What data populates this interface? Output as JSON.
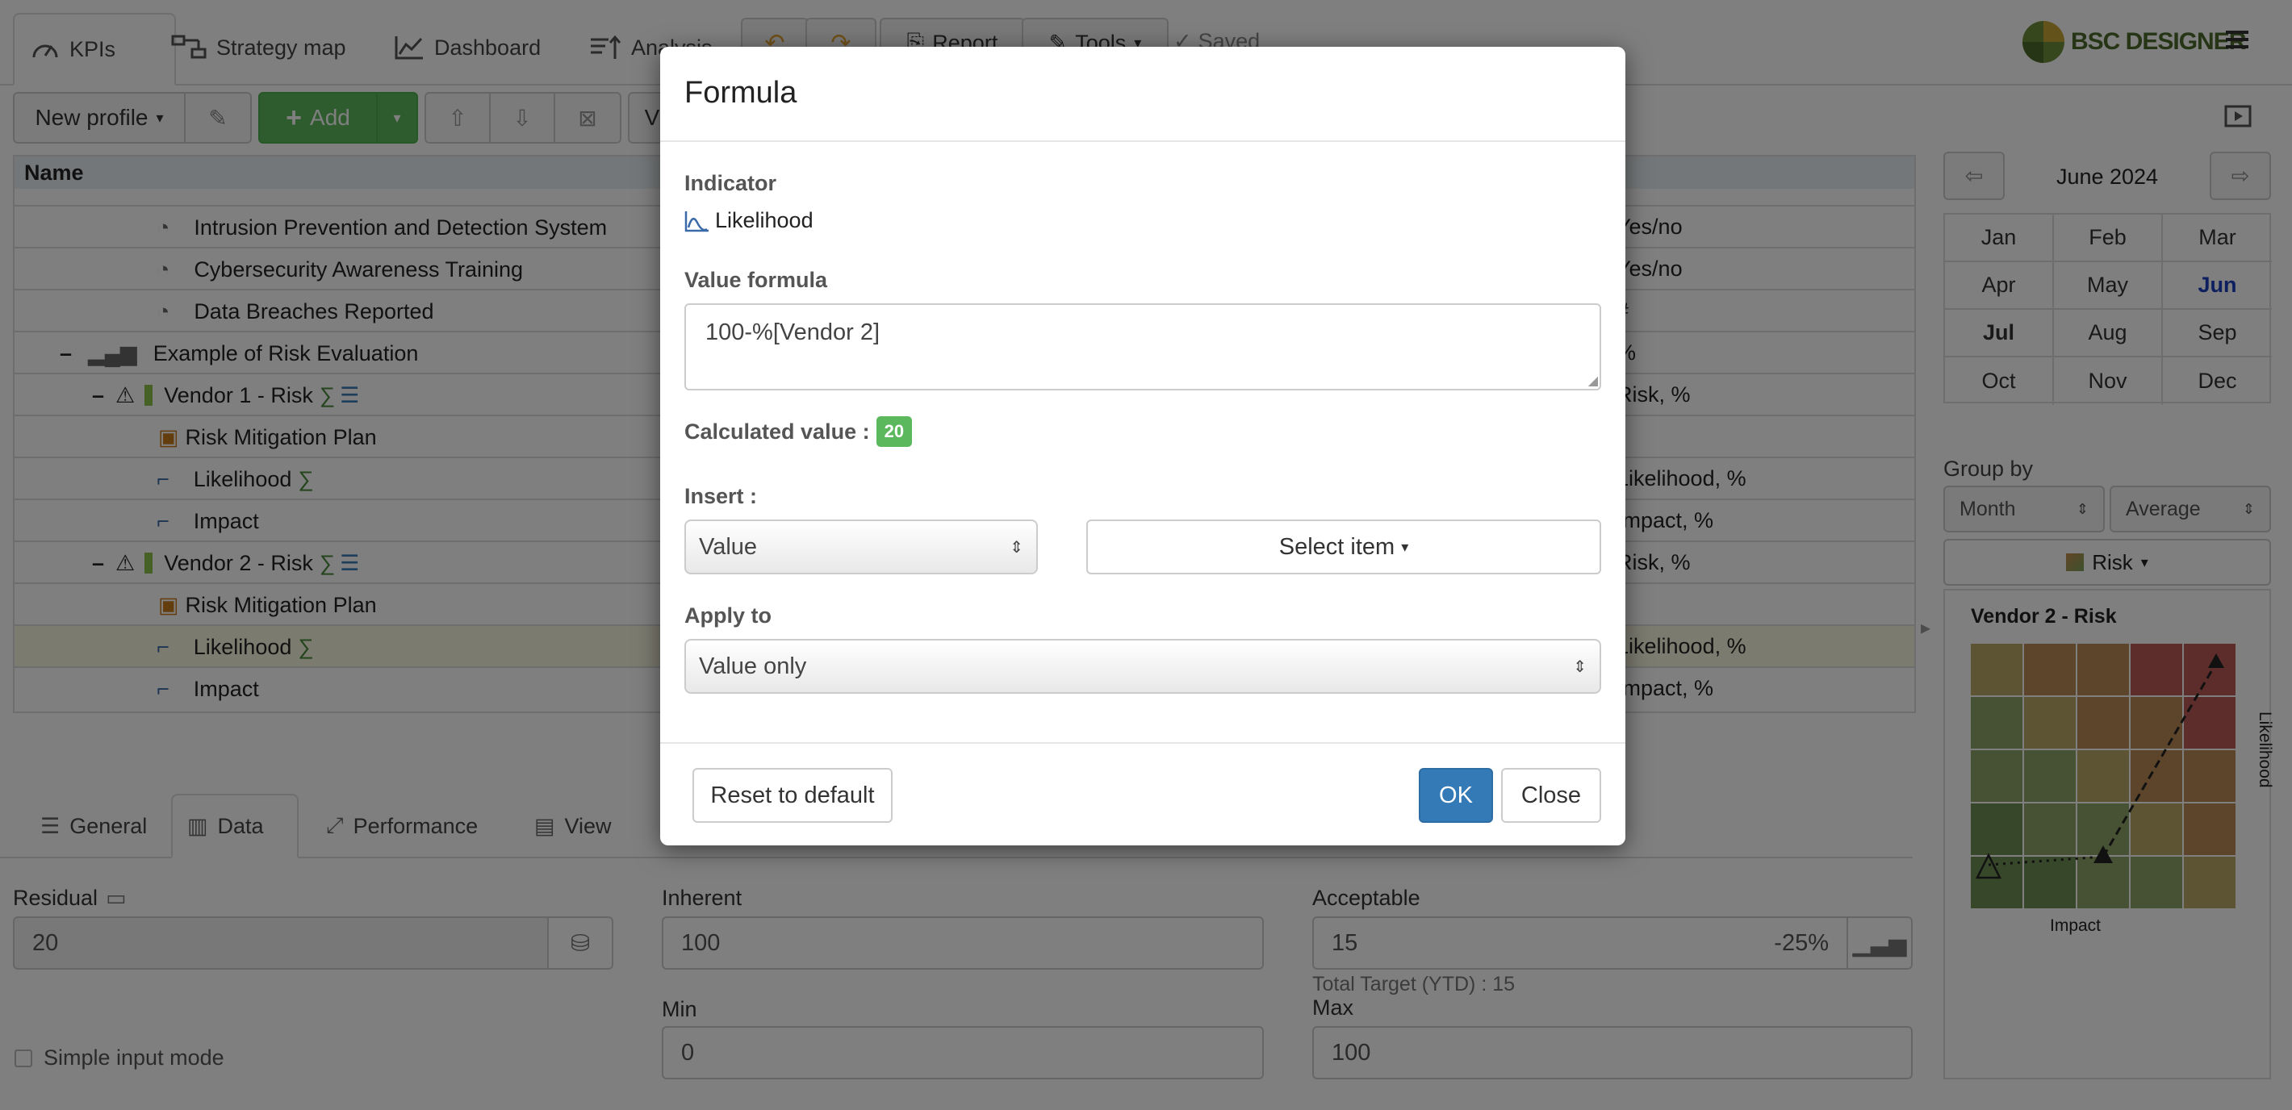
{
  "top_tabs": {
    "kpis": "KPIs",
    "strategy_map": "Strategy map",
    "dashboard": "Dashboard",
    "analysis": "Analysis",
    "report": "Report",
    "tools": "Tools",
    "saved": "Saved"
  },
  "brand": {
    "name": "BSC DESIGNER"
  },
  "toolbar": {
    "profile": "New profile",
    "add": "Add",
    "view_partial": "V"
  },
  "table": {
    "header_name": "Name",
    "rows": [
      {
        "name": "Intrusion Prevention and Detection System",
        "unit": "Yes/no"
      },
      {
        "name": "Cybersecurity Awareness Training",
        "unit": "Yes/no"
      },
      {
        "name": "Data Breaches Reported",
        "unit": "#"
      },
      {
        "name": "Example of Risk Evaluation",
        "unit": "%"
      },
      {
        "name": "Vendor 1 - Risk",
        "unit": "Risk, %"
      },
      {
        "name": "Risk Mitigation Plan",
        "unit": ""
      },
      {
        "name": "Likelihood",
        "unit": "Likelihood, %"
      },
      {
        "name": "Impact",
        "unit": "Impact, %"
      },
      {
        "name": "Vendor 2 - Risk",
        "unit": "Risk, %"
      },
      {
        "name": "Risk Mitigation Plan",
        "unit": ""
      },
      {
        "name": "Likelihood",
        "unit": "Likelihood, %"
      },
      {
        "name": "Impact",
        "unit": "Impact, %"
      }
    ]
  },
  "bottom_tabs": {
    "general": "General",
    "data": "Data",
    "performance": "Performance",
    "view": "View"
  },
  "fields": {
    "residual_label": "Residual",
    "residual_value": "20",
    "inherent_label": "Inherent",
    "inherent_value": "100",
    "acceptable_label": "Acceptable",
    "acceptable_value": "15",
    "acceptable_pct": "-25%",
    "total_target": "Total Target (YTD) : 15",
    "min_label": "Min",
    "min_value": "0",
    "max_label": "Max",
    "max_value": "100",
    "simple_mode": "Simple input mode"
  },
  "calendar": {
    "title": "June 2024",
    "months": [
      "Jan",
      "Feb",
      "Mar",
      "Apr",
      "May",
      "Jun",
      "Jul",
      "Aug",
      "Sep",
      "Oct",
      "Nov",
      "Dec"
    ],
    "selected": "Jun",
    "bold": "Jul"
  },
  "group_by": {
    "label": "Group by",
    "period": "Month",
    "aggregate": "Average",
    "view": "Risk"
  },
  "risk_chart": {
    "title": "Vendor 2 - Risk",
    "xlabel": "Impact",
    "ylabel": "Likelihood",
    "grid": [
      [
        "#b9a865",
        "#b98a55",
        "#b98a55",
        "#b85a55",
        "#b85a55"
      ],
      [
        "#8fa266",
        "#b9a865",
        "#b98a55",
        "#b98a55",
        "#b85a55"
      ],
      [
        "#8fa266",
        "#8fa266",
        "#b9a865",
        "#b98a55",
        "#b98a55"
      ],
      [
        "#6f8f54",
        "#8fa266",
        "#8fa266",
        "#b9a865",
        "#b98a55"
      ],
      [
        "#6f8f54",
        "#6f8f54",
        "#8fa266",
        "#8fa266",
        "#b9a865"
      ]
    ]
  },
  "modal": {
    "title": "Formula",
    "indicator_label": "Indicator",
    "indicator_value": "Likelihood",
    "formula_label": "Value formula",
    "formula": "100-%[Vendor 2]",
    "calc_label": "Calculated value :",
    "calc_value": "20",
    "insert_label": "Insert :",
    "insert_value": "Value",
    "select_item": "Select item",
    "apply_label": "Apply to",
    "apply_value": "Value only",
    "reset": "Reset to default",
    "ok": "OK",
    "close": "Close",
    "colors": {
      "ok": "#337ab7",
      "calc_badge": "#5cb85c"
    }
  }
}
